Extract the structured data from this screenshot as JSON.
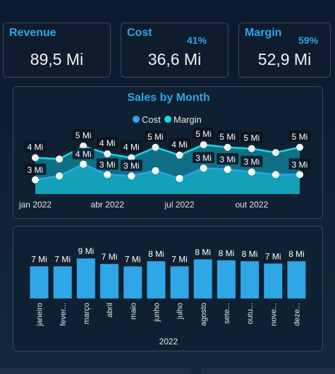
{
  "kpis": {
    "revenue": {
      "title": "Revenue",
      "value": "89,5 Mi"
    },
    "cost": {
      "title": "Cost",
      "value": "36,6 Mi",
      "pct": "41%"
    },
    "margin": {
      "title": "Margin",
      "value": "52,9 Mi",
      "pct": "59%"
    }
  },
  "colors": {
    "accent": "#2fa6e6",
    "margin": "#19d9e3",
    "bar": "#2fa6e6"
  },
  "chart_data": [
    {
      "type": "line",
      "title": "Sales by Month",
      "legend": [
        "Cost",
        "Margin"
      ],
      "x_ticks": [
        "jan 2022",
        "abr 2022",
        "jul 2022",
        "out 2022"
      ],
      "series": [
        {
          "name": "Cost",
          "values": [
            2.6,
            2.9,
            3.8,
            3.0,
            2.9,
            3.3,
            2.7,
            3.5,
            3.4,
            3.2,
            3.0,
            3.0
          ],
          "labels": [
            "3 Mi",
            "",
            "4 Mi",
            "3 Mi",
            "3 Mi",
            "",
            "",
            "3 Mi",
            "3 Mi",
            "3 Mi",
            "",
            "3 Mi"
          ]
        },
        {
          "name": "Margin",
          "values": [
            4.3,
            4.2,
            5.2,
            4.6,
            4.3,
            5.1,
            4.5,
            5.3,
            5.1,
            5.0,
            4.7,
            5.1
          ],
          "labels": [
            "4 Mi",
            "",
            "5 Mi",
            "4 Mi",
            "4 Mi",
            "5 Mi",
            "4 Mi",
            "5 Mi",
            "5 Mi",
            "5 Mi",
            "",
            "5 Mi"
          ]
        }
      ],
      "grid": false,
      "legend_position": "top"
    },
    {
      "type": "bar",
      "xlabel": "2022",
      "categories": [
        "janeiro",
        "fever...",
        "março",
        "abril",
        "maio",
        "junho",
        "julho",
        "agosto",
        "sete...",
        "outu...",
        "nove...",
        "deze..."
      ],
      "values": [
        6.9,
        6.9,
        8.6,
        7.4,
        6.9,
        8.0,
        6.9,
        8.4,
        8.2,
        8.0,
        7.5,
        8.0
      ],
      "labels": [
        "7 Mi",
        "7 Mi",
        "9 Mi",
        "7 Mi",
        "7 Mi",
        "8 Mi",
        "7 Mi",
        "8 Mi",
        "8 Mi",
        "8 Mi",
        "7 Mi",
        "8 Mi"
      ],
      "ylim": [
        0,
        10
      ],
      "grid": false
    }
  ]
}
